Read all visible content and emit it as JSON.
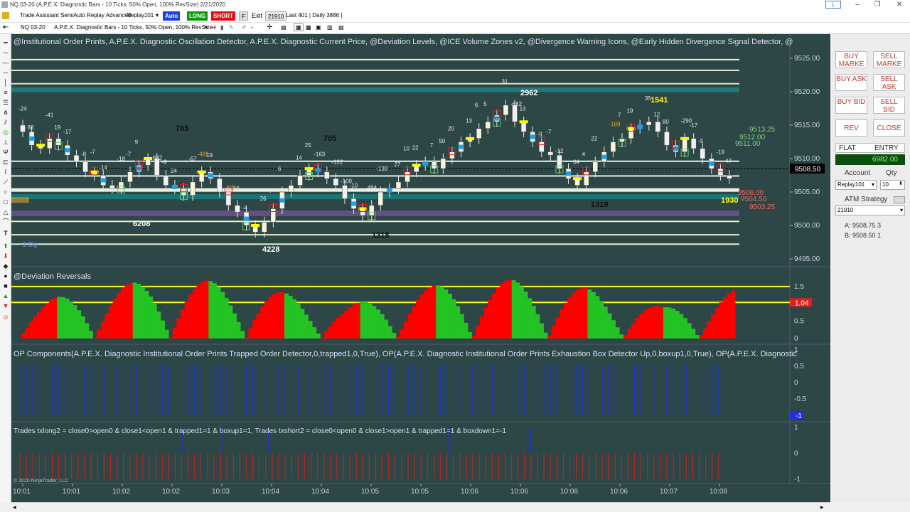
{
  "window": {
    "title": "NQ 03-20 (A.P.E.X. Diagnostic Bars - 10 Ticks, 50% Open, 100% RevSize) 2/21/2020",
    "user_badge": "L"
  },
  "toolbar1": {
    "strategy_label": "Trade Assistant SemiAuto Replay Advanced",
    "account": "Replay101",
    "auto_label": "Auto",
    "long_label": "LONG",
    "short_label": "SHORT",
    "f_label": "F",
    "exit_label": "Exit",
    "value_box": "21910",
    "last_info": "Last 401 | Daily 3886 |"
  },
  "toolbar2": {
    "instrument": "NQ 03-20",
    "bars_type": "A.P.E.X. Diagnostic Bars - 10 Ticks, 50% Open, 100% RevSize"
  },
  "panels": {
    "price_indicators": "@Institutional Order Prints, A.P.E.X. Diagnostic Oscillation Detector, A.P.E.X. Diagnostic Current Price, @Deviation Levels, @ICE Volume Zones v2, @Divergence Warning Icons, @Early Hidden Divergence Signal Detector, @",
    "deviation": "@Deviation Reversals",
    "components": "OP Components(A.P.E.X. Diagnostic Institutional Order Prints Trapped Order Detector,0,trapped1,0,True), OP(A.P.E.X. Diagnostic Institutional Order Prints Exhaustion Box Detector Up,0,boxup1,0,True), OP(A.P.E.X. Diagnostic",
    "trades": "Trades txlong2 = close0>open0 & close1<open1 & trapped1=1 & boxup1=1, Trades txshort2 = close0<open0 & close1>open1 & trapped1=1 & boxdown1=-1",
    "copyright": "© 2020 NinjaTrader, LLC",
    "dev_label": "-1 Dg"
  },
  "price_axis": [
    "9525.00",
    "9520.00",
    "9515.00",
    "9510.00",
    "9505.00",
    "9500.00",
    "9495.00"
  ],
  "current_price": "9508.50",
  "dev_axis": [
    "1.5",
    "1",
    "0.5",
    "0"
  ],
  "dev_current": "1.04",
  "comp_axis": [
    "1",
    "0.5",
    "0",
    "-0.5"
  ],
  "comp_current": "-1",
  "trades_axis": [
    "1",
    "0",
    "-1"
  ],
  "time_axis": [
    "10:01",
    "10:01",
    "10:02",
    "10:02",
    "10:03",
    "10:04",
    "10:04",
    "10:05",
    "10:05",
    "10:06",
    "10:06",
    "10:06",
    "10:06",
    "10:07",
    "10:08"
  ],
  "right_levels": [
    "9513.25",
    "9512.00",
    "9511.00",
    "9506.00",
    "9504.50",
    "9503.25"
  ],
  "big_labels": [
    "6208",
    "4228",
    "1318",
    "2962",
    "1319",
    "1541",
    "1930",
    "765",
    "705"
  ],
  "small_labels": [
    "-24",
    "88",
    "-41",
    "19",
    "-17",
    "-8",
    "-7",
    "-14",
    "-18",
    "-7",
    "9",
    "682",
    "-9",
    "24",
    "-67",
    "-480",
    "19",
    "-119",
    "19",
    "-4",
    "26",
    "7",
    "6",
    "14",
    "25",
    "-163",
    "-122",
    "-109",
    "-10",
    "494",
    "-139",
    "27",
    "10",
    "22",
    "7",
    "50",
    "20",
    "13",
    "6",
    "5",
    "31",
    "-682",
    "13",
    "-9",
    "-7",
    "-12",
    "64",
    "4",
    "22",
    "-189",
    "7",
    "19",
    "35",
    "12",
    "80",
    "-290",
    "-17",
    "-5",
    "-19",
    "47"
  ],
  "order_panel": {
    "buy_market": "BUY MARKE",
    "sell_market": "SELL MARKE",
    "buy_ask": "BUY ASK",
    "sell_ask": "SELL ASK",
    "buy_bid": "BUY BID",
    "sell_bid": "SELL BID",
    "rev": "REV",
    "close": "CLOSE",
    "flat": "FLAT",
    "entry": "ENTRY",
    "pnl_value": "6982.00",
    "account_label": "Account",
    "qty_label": "Qty",
    "account_value": "Replay101",
    "qty_value": "10",
    "atm_label": "ATM Strategy",
    "atm_value": "21910",
    "ask_line": "A: 9508.75 3",
    "bid_line": "B: 9508.50 1"
  },
  "colors": {
    "chart_bg": "#2d4646",
    "up_candle": "#f5f5dc",
    "down_candle": "#f0f0f0",
    "dev_red": "#ff0000",
    "dev_green": "#22c322",
    "yellow": "#ffff00",
    "pnl_bg": "#0d4d0d",
    "pnl_fg": "#7fff7f"
  }
}
